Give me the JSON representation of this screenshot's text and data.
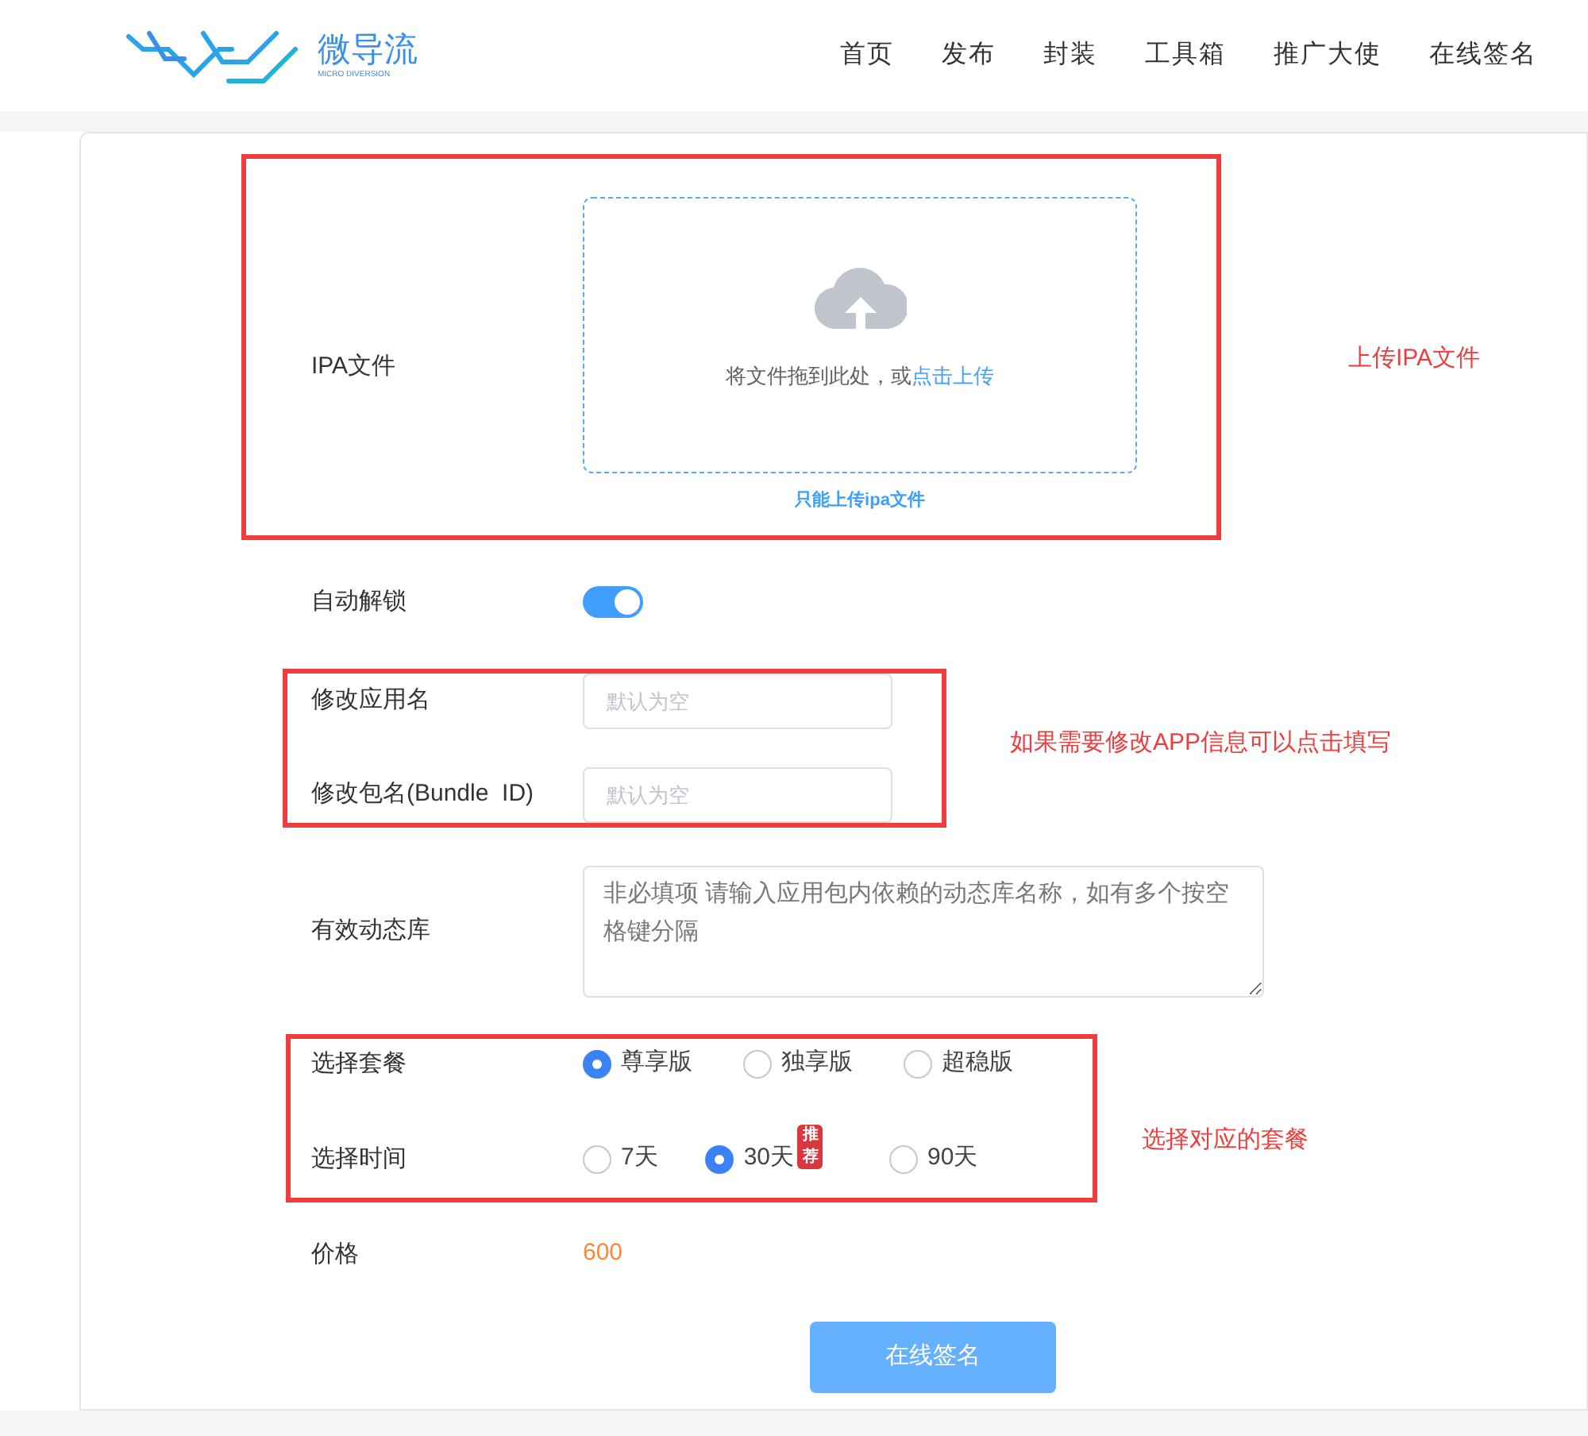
{
  "header": {
    "logo": {
      "name": "微导流",
      "tagline": "MICRO DIVERSION"
    },
    "nav": [
      {
        "label": "首页"
      },
      {
        "label": "发布"
      },
      {
        "label": "封装"
      },
      {
        "label": "工具箱"
      },
      {
        "label": "推广大使"
      },
      {
        "label": "在线签名"
      }
    ]
  },
  "form": {
    "upload": {
      "label": "IPA文件",
      "prompt": "将文件拖到此处，或",
      "link": "点击上传",
      "hint": "只能上传ipa文件"
    },
    "auto_unlock": {
      "label": "自动解锁",
      "on": true
    },
    "app_name": {
      "label": "修改应用名",
      "placeholder": "默认为空"
    },
    "bundle_id": {
      "label": "修改包名(Bundle  ID)",
      "placeholder": "默认为空"
    },
    "dylib": {
      "label": "有效动态库",
      "placeholder": "非必填项 请输入应用包内依赖的动态库名称，如有多个按空格键分隔"
    },
    "plan": {
      "label": "选择套餐",
      "options": [
        {
          "label": "尊享版",
          "selected": true
        },
        {
          "label": "独享版",
          "selected": false
        },
        {
          "label": "超稳版",
          "selected": false
        }
      ]
    },
    "duration": {
      "label": "选择时间",
      "options": [
        {
          "label": "7天",
          "selected": false
        },
        {
          "label": "30天",
          "selected": true,
          "badge": "推荐"
        },
        {
          "label": "90天",
          "selected": false
        }
      ]
    },
    "price": {
      "label": "价格",
      "value": "600"
    },
    "submit": "在线签名"
  },
  "annotations": [
    "上传IPA文件",
    "如果需要修改APP信息可以点击填写",
    "选择对应的套餐"
  ]
}
